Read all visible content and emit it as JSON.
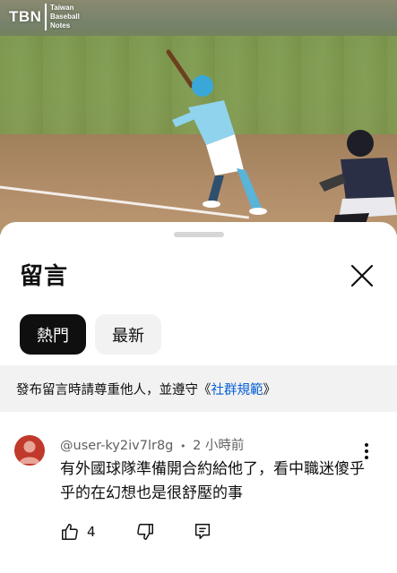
{
  "video": {
    "logo_mark": "TBN",
    "logo_sub_1": "Taiwan",
    "logo_sub_2": "Baseball",
    "logo_sub_3": "Notes"
  },
  "header": {
    "title": "留言",
    "close_icon": "close-icon"
  },
  "chips": [
    {
      "label": "熱門",
      "selected": true
    },
    {
      "label": "最新",
      "selected": false
    }
  ],
  "notice": {
    "text": "發布留言時請尊重他人，並遵守《",
    "link": "社群規範",
    "suffix": "》"
  },
  "comment": {
    "username": "@user-ky2iv7lr8g",
    "separator": "•",
    "time": "2 小時前",
    "text": "有外國球隊準備開合約給他了，看中職迷傻乎乎的在幻想也是很舒壓的事",
    "likes": "4",
    "avatar_color": "#c0392b"
  },
  "colors": {
    "link": "#065fd4",
    "chip_active_bg": "#0f0f0f",
    "chip_inactive_bg": "#f2f2f2",
    "notice_bg": "#f2f2f2"
  }
}
